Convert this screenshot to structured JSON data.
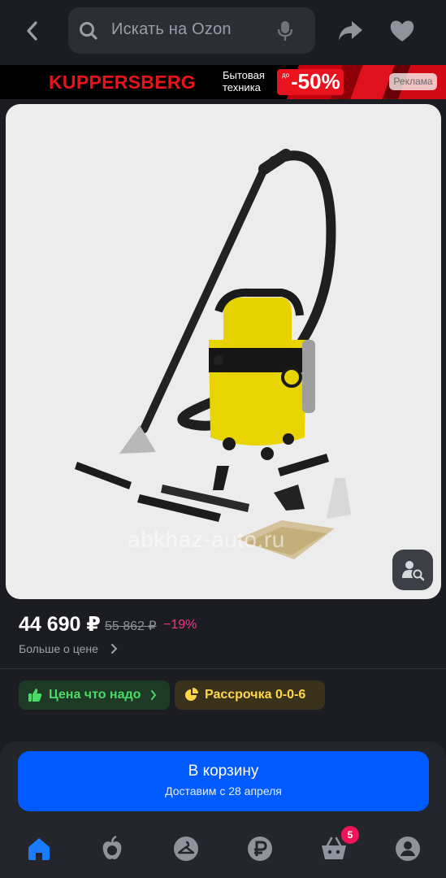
{
  "search": {
    "placeholder": "Искать на Ozon"
  },
  "ad": {
    "brand": "KUPPERSBERG",
    "subtitle_line1": "Бытовая",
    "subtitle_line2": "техника",
    "sale_prefix": "до",
    "sale_value": "-50%",
    "tag": "Реклама"
  },
  "product": {
    "watermark": "abkhaz-auto.ru"
  },
  "price": {
    "current": "44 690 ₽",
    "old": "55 862 ₽",
    "discount": "−19%",
    "more_link": "Больше о цене"
  },
  "chips": [
    {
      "label": "Цена что надо",
      "icon": "thumbs-up-icon"
    },
    {
      "label": "Рассрочка 0-0-6",
      "icon": "pie-chart-icon"
    }
  ],
  "cart": {
    "title": "В корзину",
    "subtitle": "Доставим с 28 апреля"
  },
  "tabbar": {
    "items": [
      {
        "name": "home",
        "icon": "home-icon",
        "active": true
      },
      {
        "name": "fresh",
        "icon": "apple-icon"
      },
      {
        "name": "catalog",
        "icon": "hanger-icon"
      },
      {
        "name": "finance",
        "icon": "ruble-icon"
      },
      {
        "name": "cart",
        "icon": "basket-icon"
      },
      {
        "name": "profile",
        "icon": "profile-icon"
      }
    ],
    "cart_badge": "5"
  },
  "colors": {
    "background": "#1b1d22",
    "accent": "#005bff",
    "discount": "#f2358c",
    "green_chip": "#4cd964",
    "yellow_chip": "#ffd64a",
    "ad_red": "#e8131c"
  }
}
